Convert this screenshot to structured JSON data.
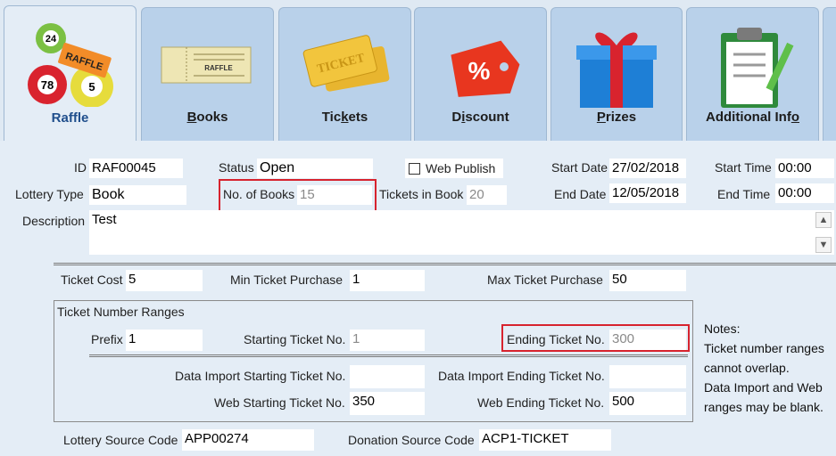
{
  "tabs": [
    {
      "label": "Raffle",
      "icon": "raffle-balls-icon",
      "active": true
    },
    {
      "label": "Books",
      "icon": "ticket-book-icon"
    },
    {
      "label": "Tickets",
      "icon": "ticket-icon"
    },
    {
      "label": "Discount",
      "icon": "discount-tag-icon"
    },
    {
      "label": "Prizes",
      "icon": "gift-box-icon"
    },
    {
      "label": "Additional Info",
      "icon": "clipboard-icon"
    }
  ],
  "tab_icon_text": {
    "ball1": "24",
    "ball2": "78",
    "ball3": "5",
    "ticket": "RAFFLE",
    "yellow_ticket": "TICKET",
    "book": "RAFFLE",
    "percent": "%"
  },
  "form": {
    "id_label": "ID",
    "id_value": "RAF00045",
    "status_label": "Status",
    "status_value": "Open",
    "web_publish_label": "Web Publish",
    "start_date_label": "Start Date",
    "start_date_value": "27/02/2018",
    "start_time_label": "Start Time",
    "start_time_value": "00:00",
    "lottery_type_label": "Lottery Type",
    "lottery_type_value": "Book",
    "no_books_label": "No. of Books",
    "no_books_value": "15",
    "tickets_in_book_label": "Tickets in Book",
    "tickets_in_book_value": "20",
    "end_date_label": "End Date",
    "end_date_value": "12/05/2018",
    "end_time_label": "End Time",
    "end_time_value": "00:00",
    "description_label": "Description",
    "description_value": "Test",
    "ticket_cost_label": "Ticket Cost",
    "ticket_cost_value": "5",
    "min_purchase_label": "Min Ticket Purchase",
    "min_purchase_value": "1",
    "max_purchase_label": "Max Ticket Purchase",
    "max_purchase_value": "50",
    "ranges_title": "Ticket Number Ranges",
    "prefix_label": "Prefix",
    "prefix_value": "1",
    "starting_no_label": "Starting Ticket No.",
    "starting_no_value": "1",
    "ending_no_label": "Ending Ticket No.",
    "ending_no_value": "300",
    "di_start_label": "Data Import Starting Ticket No.",
    "di_start_value": "",
    "di_end_label": "Data Import Ending Ticket No.",
    "di_end_value": "",
    "web_start_label": "Web Starting Ticket No.",
    "web_start_value": "350",
    "web_end_label": "Web Ending Ticket No.",
    "web_end_value": "500",
    "notes_lines": [
      "Notes:",
      "Ticket number ranges",
      "cannot overlap.",
      "Data Import and Web",
      "ranges may be blank."
    ],
    "lottery_source_label": "Lottery Source Code",
    "lottery_source_value": "APP00274",
    "donation_source_label": "Donation Source Code",
    "donation_source_value": "ACP1-TICKET"
  },
  "colors": {
    "highlight": "#d7232e",
    "tab_active_text": "#1f4e8c"
  }
}
